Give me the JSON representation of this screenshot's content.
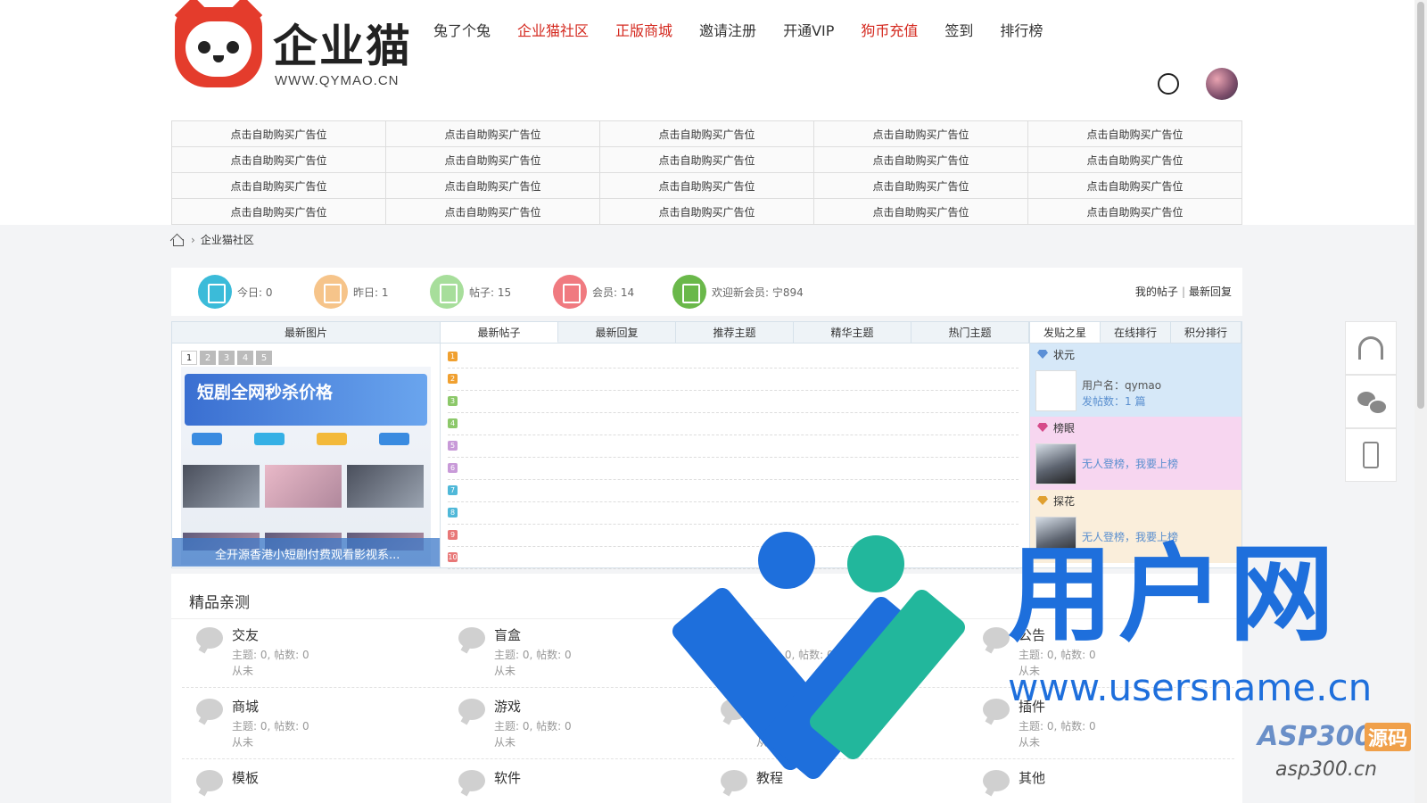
{
  "logo": {
    "title": "企业猫",
    "url": "WWW.QYMAO.CN"
  },
  "nav": [
    {
      "label": "兔了个兔",
      "color": "#333333"
    },
    {
      "label": "企业猫社区",
      "color": "#d4281e"
    },
    {
      "label": "正版商城",
      "color": "#d4281e"
    },
    {
      "label": "邀请注册",
      "color": "#333333"
    },
    {
      "label": "开通VIP",
      "color": "#333333"
    },
    {
      "label": "狗币充值",
      "color": "#d4281e"
    },
    {
      "label": "签到",
      "color": "#333333"
    },
    {
      "label": "排行榜",
      "color": "#333333"
    }
  ],
  "ad_label": "点击自助购买广告位",
  "breadcrumb": {
    "current": "企业猫社区"
  },
  "stats": {
    "today": "今日: 0",
    "yesterday": "昨日: 1",
    "posts": "帖子: 15",
    "members": "会员: 14",
    "welcome": "欢迎新会员: 宁894",
    "my_posts": "我的帖子",
    "latest_reply": "最新回复",
    "colors": [
      "#3bbbd9",
      "#f6c48a",
      "#a7de9b",
      "#f07a80",
      "#6ab84a"
    ]
  },
  "images": {
    "header": "最新图片",
    "pages": [
      "1",
      "2",
      "3",
      "4",
      "5"
    ],
    "banner": "短剧全网秒杀价格",
    "caption": "全开源香港小短剧付费观看影视系..."
  },
  "tabs": [
    "最新帖子",
    "最新回复",
    "推荐主题",
    "精华主题",
    "热门主题"
  ],
  "post_numbers": [
    "1",
    "2",
    "3",
    "4",
    "5",
    "6",
    "7",
    "8",
    "9",
    "10"
  ],
  "post_colors": [
    "#f0a030",
    "#f0a030",
    "#8cc86a",
    "#8cc86a",
    "#c89ad8",
    "#c89ad8",
    "#4fb8d8",
    "#4fb8d8",
    "#e87878",
    "#e87878"
  ],
  "rank": {
    "tabs": [
      "发贴之星",
      "在线排行",
      "积分排行"
    ],
    "sections": [
      {
        "title": "状元",
        "bg": "#d6e8f8",
        "line1": "用户名：qymao",
        "line2": "发帖数：1 篇"
      },
      {
        "title": "榜眼",
        "bg": "#f7d6f0",
        "line1": "无人登榜，我要上榜",
        "line2": ""
      },
      {
        "title": "探花",
        "bg": "#faeedb",
        "line1": "无人登榜，我要上榜",
        "line2": ""
      }
    ]
  },
  "section": {
    "title": "精品亲测",
    "forums": [
      {
        "name": "交友",
        "meta": "主题: 0, 帖数: 0",
        "last": "从未"
      },
      {
        "name": "盲盒",
        "meta": "主题: 0, 帖数: 0",
        "last": "从未"
      },
      {
        "name": "",
        "meta": "主题: 0, 帖数: 0",
        "last": "从未"
      },
      {
        "name": "公告",
        "meta": "主题: 0, 帖数: 0",
        "last": "从未"
      },
      {
        "name": "商城",
        "meta": "主题: 0, 帖数: 0",
        "last": "从未"
      },
      {
        "name": "游戏",
        "meta": "主题: 0, 帖数: 0",
        "last": "从未"
      },
      {
        "name": "",
        "meta": "主题: 0, 帖数: 0",
        "last": "从未"
      },
      {
        "name": "插件",
        "meta": "主题: 0, 帖数: 0",
        "last": "从未"
      },
      {
        "name": "模板",
        "meta": "",
        "last": ""
      },
      {
        "name": "软件",
        "meta": "",
        "last": ""
      },
      {
        "name": "教程",
        "meta": "",
        "last": ""
      },
      {
        "name": "其他",
        "meta": "",
        "last": ""
      }
    ]
  },
  "watermark": {
    "brand": "用户网",
    "url": "www.usersname.cn",
    "asp": "ASP300",
    "src": "源码",
    "asp_url": "asp300.cn"
  }
}
